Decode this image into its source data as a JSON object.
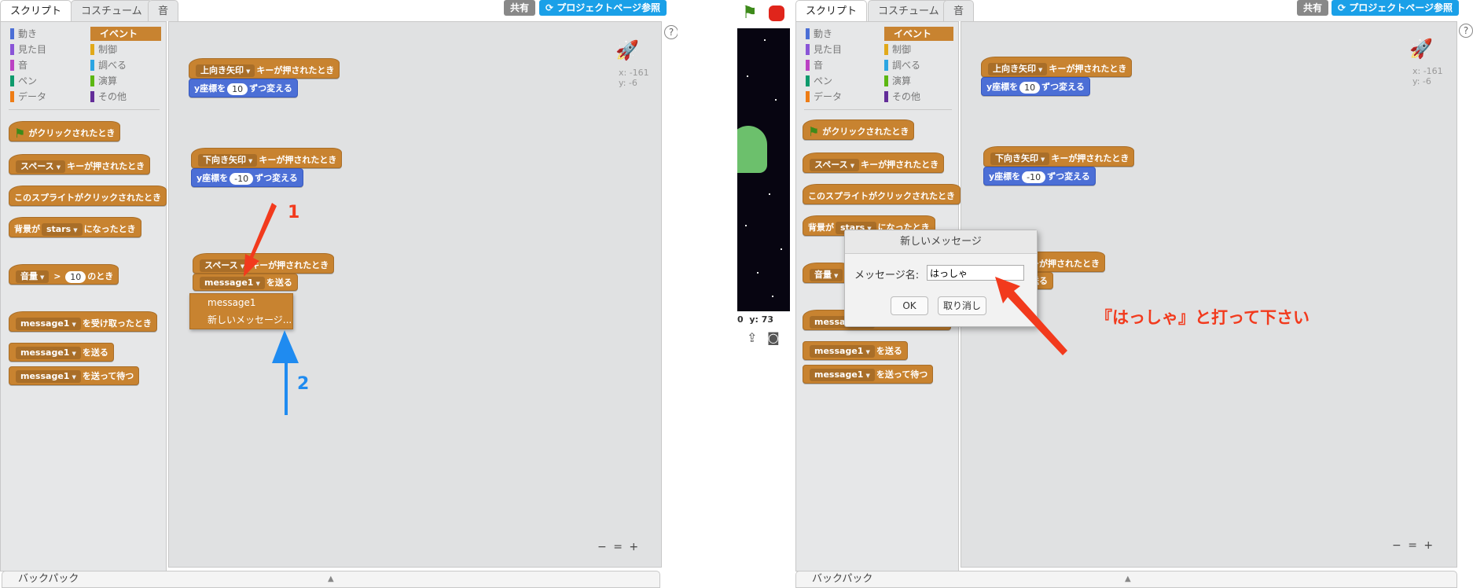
{
  "tabs": [
    "スクリプト",
    "コスチューム",
    "音"
  ],
  "top": {
    "share": "共有",
    "project_page": "プロジェクトページ参照"
  },
  "categories": {
    "left": [
      "動き",
      "見た目",
      "音",
      "ペン",
      "データ"
    ],
    "right": [
      "イベント",
      "制御",
      "調べる",
      "演算",
      "その他"
    ]
  },
  "palette": {
    "green_flag_text": "がクリックされたとき",
    "space_key": "スペース",
    "key_pressed": "キーが押されたとき",
    "sprite_clicked": "このスプライトがクリックされたとき",
    "backdrop_prefix": "背景が",
    "backdrop_value": "stars",
    "backdrop_suffix": "になったとき",
    "loudness": "音量",
    "gt": ">",
    "loudness_value": "10",
    "loudness_suffix": "のとき",
    "message": "message1",
    "receive": "を受け取ったとき",
    "send": "を送る",
    "send_wait": "を送って待つ"
  },
  "script": {
    "up_key": "上向き矢印",
    "down_key": "下向き矢印",
    "key_pressed": "キーが押されたとき",
    "change_y": "y座標を",
    "change_y_suffix": "ずつ変える",
    "up_value": "10",
    "down_value": "-10",
    "space_key": "スペース",
    "message": "message1",
    "send": "を送る"
  },
  "coords": {
    "x": "x: -161",
    "y": "y: -6"
  },
  "dropdown": {
    "items": [
      "message1",
      "新しいメッセージ..."
    ]
  },
  "annotations": {
    "one": "1",
    "two": "2",
    "instruction": "『はっしゃ』と打って下さい"
  },
  "dialog": {
    "title": "新しいメッセージ",
    "label": "メッセージ名:",
    "value": "はっしゃ",
    "ok": "OK",
    "cancel": "取り消し"
  },
  "stage": {
    "x_label": "0",
    "y_label": "y:",
    "y_value": "73"
  },
  "backpack": "バックパック",
  "zoom": {
    "out": "−",
    "reset": "=",
    "in": "+"
  },
  "help": "?",
  "colors": {
    "events": "#c88330",
    "motion": "#4c6fd6",
    "looks": "#8a55d7",
    "sound": "#bb42c3",
    "pen": "#0e9a6c",
    "data": "#ee7d16",
    "control": "#e1a91a",
    "sensing": "#2ca5e2",
    "operators": "#5cb712",
    "more": "#632d99",
    "red_arrow": "#f23a1d",
    "blue_arrow": "#1f8bf0"
  }
}
